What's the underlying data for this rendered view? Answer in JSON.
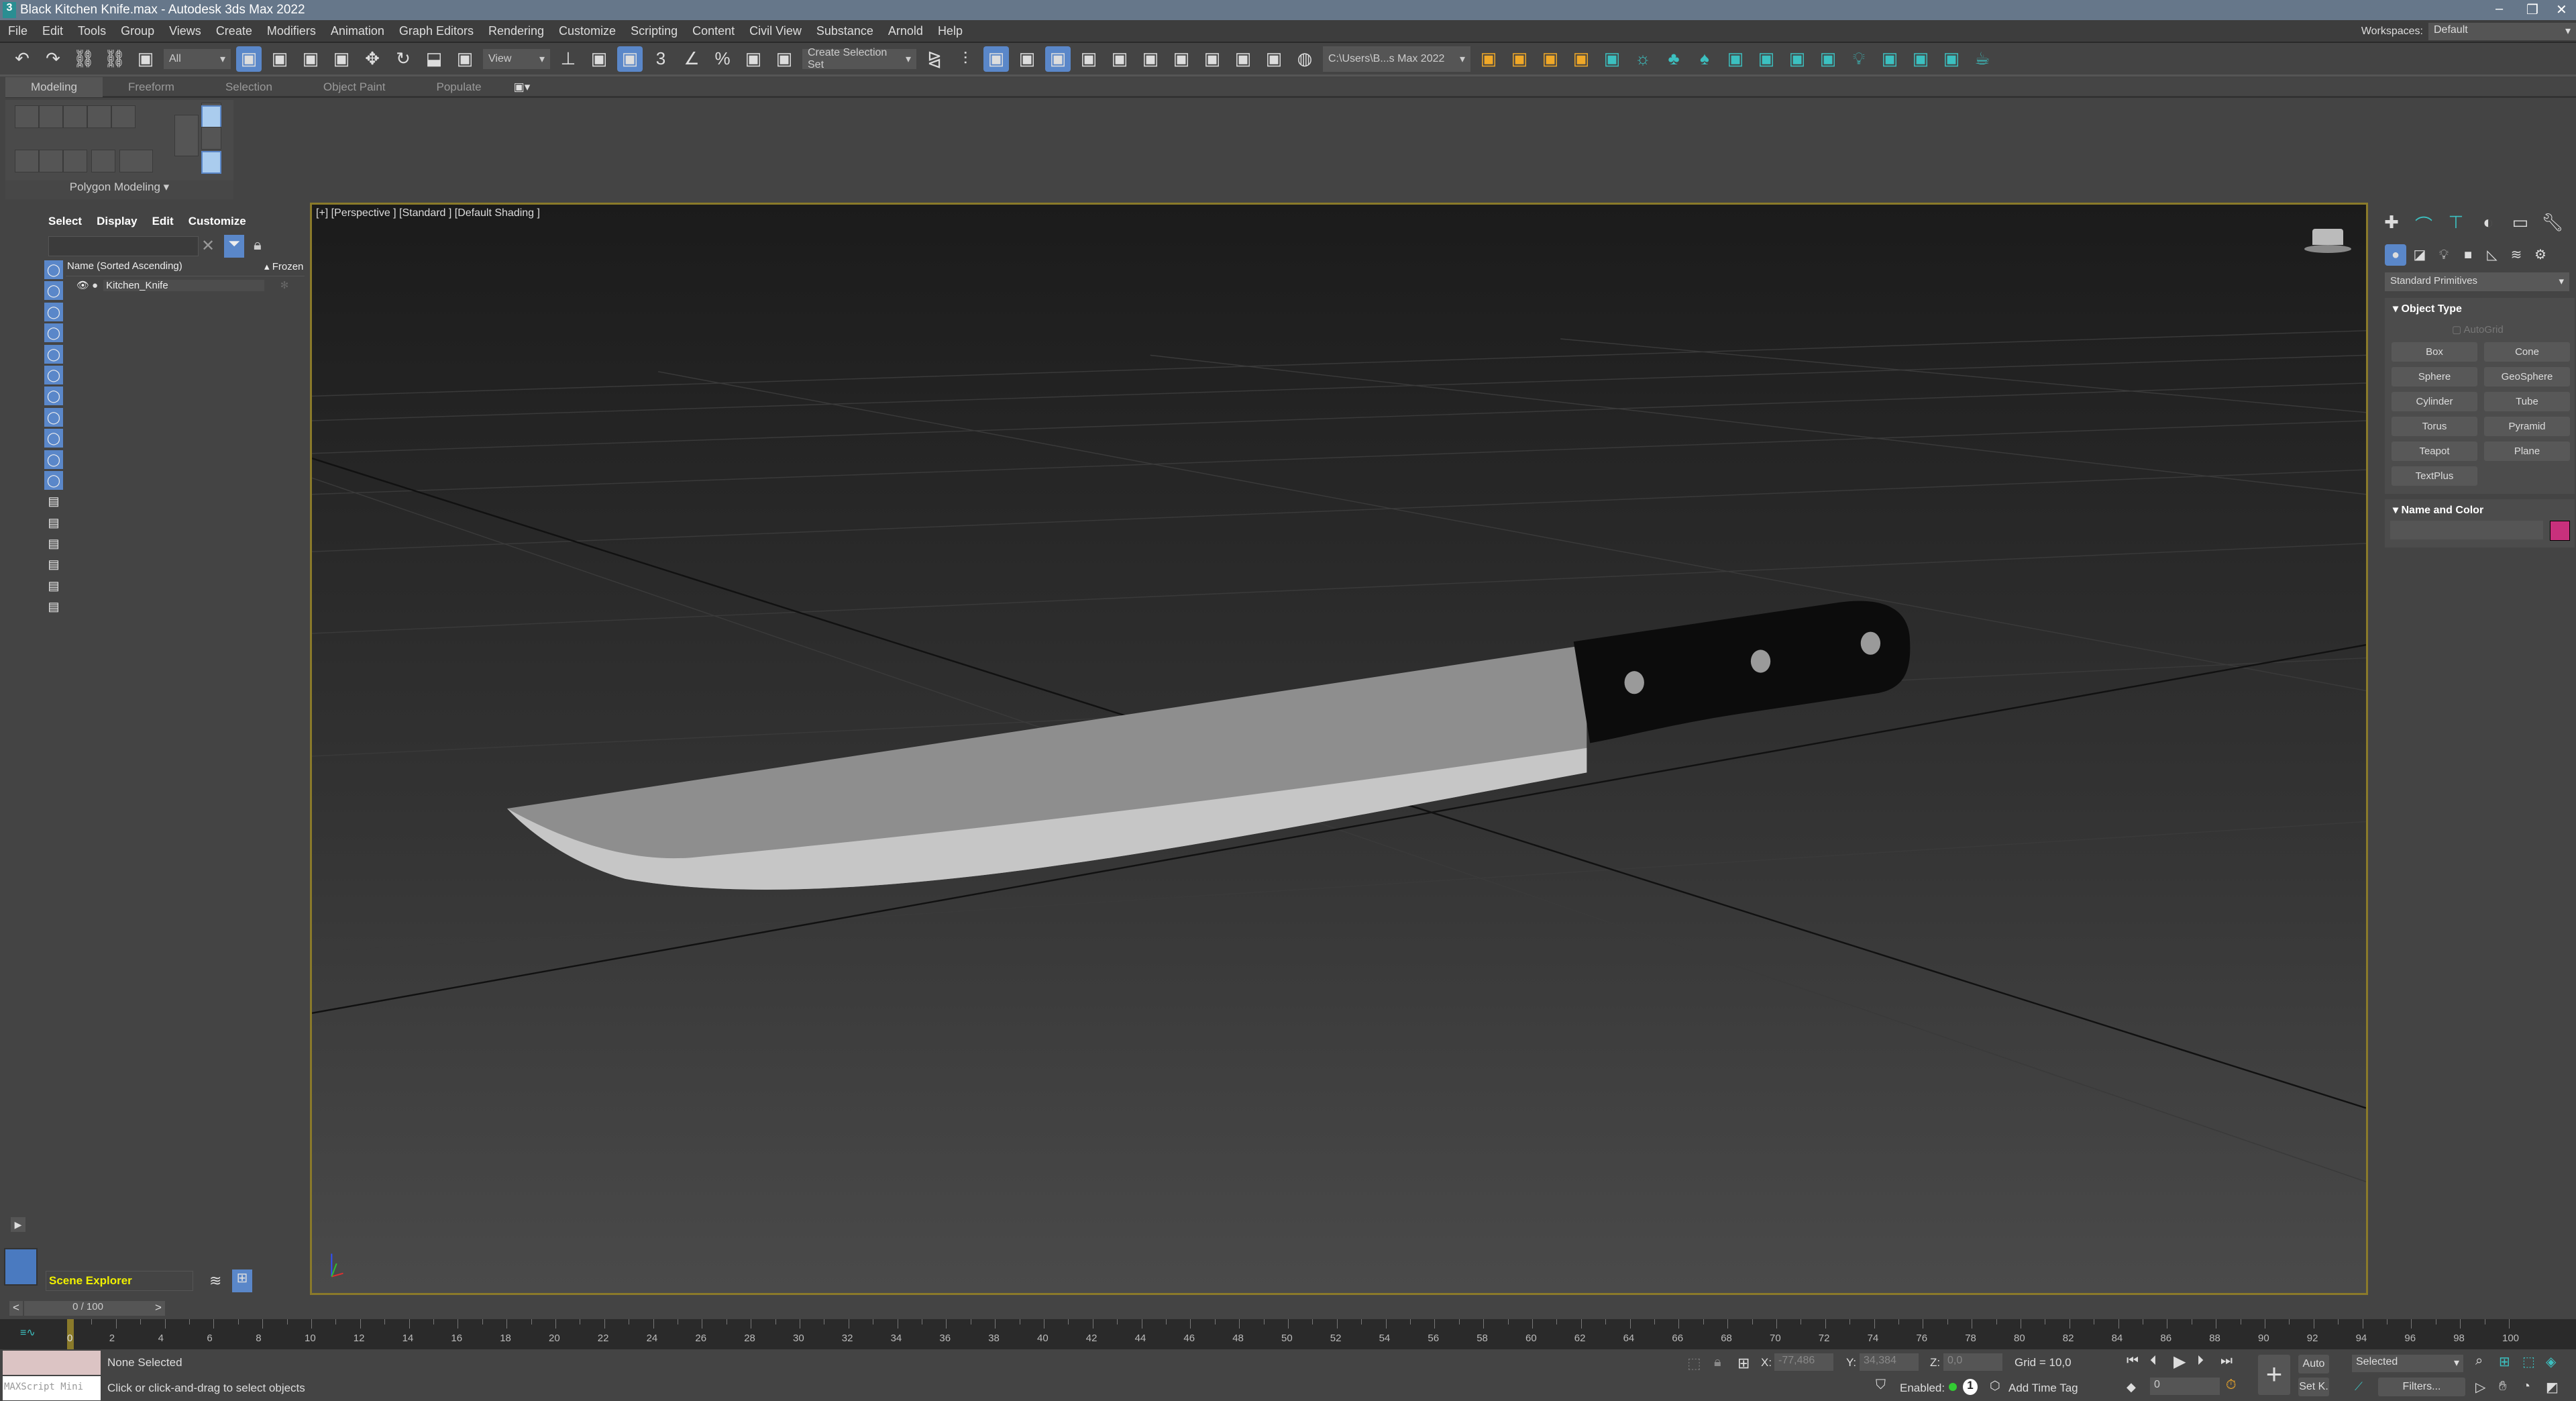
{
  "window": {
    "title": "Black Kitchen Knife.max - Autodesk 3ds Max 2022",
    "app_icon": "3ds-max-logo",
    "controls": [
      "minimize-icon",
      "restore-icon",
      "close-icon"
    ]
  },
  "menu": [
    "File",
    "Edit",
    "Tools",
    "Group",
    "Views",
    "Create",
    "Modifiers",
    "Animation",
    "Graph Editors",
    "Rendering",
    "Customize",
    "Scripting",
    "Content",
    "Civil View",
    "Substance",
    "Arnold",
    "Help"
  ],
  "workspaces": {
    "label": "Workspaces:",
    "value": "Default"
  },
  "toolbar": {
    "selection_filter": "All",
    "reference_coord": "View",
    "named_selection": "Create Selection Set",
    "project_path": "C:\\Users\\B...s Max 2022",
    "icons_a": [
      "undo-icon",
      "redo-icon",
      "link-icon",
      "unlink-icon",
      "bind-space-warp-icon"
    ],
    "icons_b": [
      "select-object-icon",
      "select-by-name-icon",
      "rect-selection-icon",
      "window-crossing-icon",
      "move-icon",
      "rotate-icon",
      "scale-icon",
      "placement-icon"
    ],
    "icons_c": [
      "pivot-icon",
      "snap-move-icon",
      "keyboard-shortcut-override-icon",
      "snap-3d-icon",
      "angle-snap-icon",
      "percent-snap-icon",
      "spinner-snap-icon",
      "edit-named-sets-icon"
    ],
    "icons_d": [
      "mirror-icon",
      "align-icon",
      "toggle-scene-explorer-icon",
      "toggle-layer-explorer-icon",
      "toggle-ribbon-icon",
      "curve-editor-icon",
      "dope-sheet-icon",
      "schematic-view-icon",
      "material-editor-icon",
      "render-setup-icon",
      "rendered-frame-icon",
      "render-production-icon",
      "arnold-icon"
    ],
    "icons_e": [
      "set-project-folder-icon",
      "open-project-icon",
      "arnold-camera-icon",
      "arnold-light-icon",
      "physical-light-icon",
      "sun-icon",
      "tree-icon",
      "tree2-icon",
      "render-view-icon",
      "light-mixer-icon",
      "gear-render-icon",
      "camera-view-icon",
      "light-bulb-icon",
      "viewport-layout-icon",
      "safe-frame-icon",
      "frame-icon",
      "teapot-icon"
    ]
  },
  "ribbon": {
    "tabs": [
      "Modeling",
      "Freeform",
      "Selection",
      "Object Paint",
      "Populate"
    ],
    "active": "Modeling",
    "panel_label": "Polygon Modeling"
  },
  "scene_explorer": {
    "menu": [
      "Select",
      "Display",
      "Edit",
      "Customize"
    ],
    "search_value": "",
    "columns": [
      "Name (Sorted Ascending)",
      "Frozen"
    ],
    "rows": [
      {
        "name": "Kitchen_Knife"
      }
    ],
    "filter_icons": [
      "geometry-icon",
      "shapes-icon",
      "light-icon",
      "camera-icon",
      "helper-icon",
      "space-warp-icon",
      "group-icon",
      "xref-icon",
      "bone-icon",
      "container-icon",
      "frozen-icon",
      "hidden-icon",
      "display-all-icon",
      "display-none-icon",
      "invert-icon",
      "filter-icon",
      "layer-icon"
    ],
    "footer_label": "Scene Explorer"
  },
  "viewport": {
    "label": "[+] [Perspective ] [Standard ] [Default Shading ]"
  },
  "command_panel": {
    "tabs": [
      "create-icon",
      "modify-icon",
      "hierarchy-icon",
      "motion-icon",
      "display-icon",
      "utilities-icon"
    ],
    "categories": [
      "geometry-icon",
      "shapes-icon",
      "lights-icon",
      "cameras-icon",
      "helpers-icon",
      "space-warps-icon",
      "systems-icon"
    ],
    "dropdown": "Standard Primitives",
    "object_type": {
      "title": "Object Type",
      "autogrid": "AutoGrid",
      "buttons": [
        "Box",
        "Cone",
        "Sphere",
        "GeoSphere",
        "Cylinder",
        "Tube",
        "Torus",
        "Pyramid",
        "Teapot",
        "Plane",
        "TextPlus"
      ]
    },
    "name_color": {
      "title": "Name and Color",
      "name_value": "",
      "color": "#c8307c"
    }
  },
  "time_slider": {
    "label": "0 / 100",
    "prev": "<",
    "next": ">"
  },
  "trackbar": {
    "start": 0,
    "end": 100,
    "step": 2,
    "current": 0
  },
  "status": {
    "selection": "None Selected",
    "prompt": "Click or click-and-drag to select objects",
    "maxscript": "MAXScript Mini",
    "x_label": "X:",
    "x": "-77,486",
    "y_label": "Y:",
    "y": "34,384",
    "z_label": "Z:",
    "z": "0,0",
    "grid": "Grid = 10,0",
    "enabled_label": "Enabled:",
    "enabled_count": "1",
    "add_time_tag": "Add Time Tag",
    "auto_key": "Auto",
    "set_key": "Set K.",
    "key_filter": "Selected",
    "filters": "Filters...",
    "frame": "0"
  },
  "colors": {
    "accent": "#5a87c9",
    "viewport_border": "#8a7a2a",
    "titlebar": "#66778a"
  }
}
